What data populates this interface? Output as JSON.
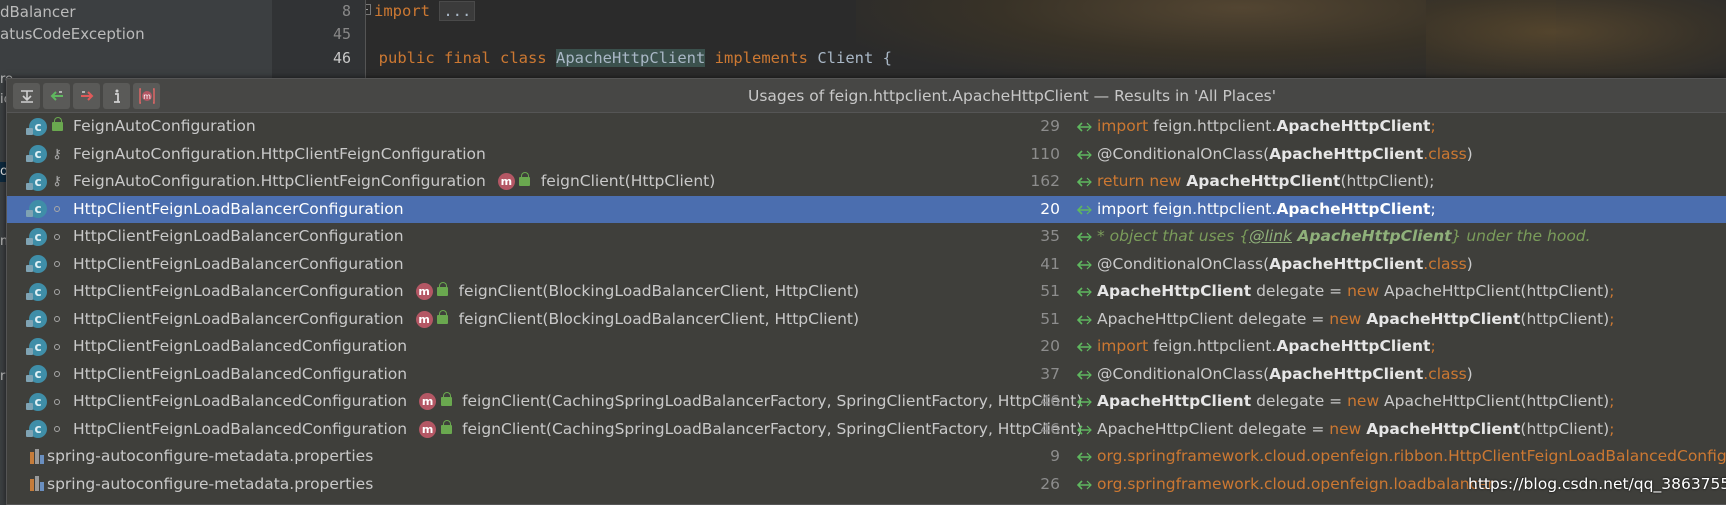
{
  "project_tree": {
    "items": [
      "dBalancer",
      "atusCodeException"
    ],
    "stubs": [
      "re",
      "ic",
      "or",
      "m",
      "ra"
    ]
  },
  "editor": {
    "line_numbers": [
      "8",
      "45",
      "46"
    ],
    "code": {
      "import_kw": "import",
      "import_folded": "...",
      "public_kw": "public final class",
      "class_name": "ApacheHttpClient",
      "implements_kw": "implements",
      "client": "Client {"
    }
  },
  "usages_popup": {
    "title": "Usages of feign.httpclient.ApacheHttpClient — Results in 'All Places'",
    "toolbar": [
      "expand-all-icon",
      "previous-occurrence-icon",
      "next-occurrence-icon",
      "info-icon",
      "method-filter-icon"
    ],
    "rows": [
      {
        "icon": "class-icon",
        "vis": "lock",
        "name": "FeignAutoConfiguration",
        "method": "",
        "line": "29",
        "code": [
          {
            "t": "import ",
            "c": "kw"
          },
          {
            "t": "feign.httpclient.",
            "c": "txt"
          },
          {
            "t": "ApacheHttpClient",
            "c": "b"
          },
          {
            "t": ";",
            "c": "kw"
          }
        ]
      },
      {
        "icon": "class-icon",
        "vis": "key",
        "name": "FeignAutoConfiguration.HttpClientFeignConfiguration",
        "method": "",
        "line": "110",
        "code": [
          {
            "t": "@ConditionalOnClass(",
            "c": "txt"
          },
          {
            "t": "ApacheHttpClient",
            "c": "b"
          },
          {
            "t": ".class",
            "c": "kw"
          },
          {
            "t": ")",
            "c": "txt"
          }
        ]
      },
      {
        "icon": "class-icon",
        "vis": "key",
        "name": "FeignAutoConfiguration.HttpClientFeignConfiguration",
        "method": "feignClient(HttpClient)",
        "line": "162",
        "code": [
          {
            "t": "return new ",
            "c": "kw"
          },
          {
            "t": "ApacheHttpClient",
            "c": "b"
          },
          {
            "t": "(httpClient);",
            "c": "txt"
          }
        ]
      },
      {
        "icon": "class-icon",
        "vis": "dot",
        "name": "HttpClientFeignLoadBalancerConfiguration",
        "method": "",
        "line": "20",
        "selected": true,
        "code": [
          {
            "t": "import ",
            "c": "txt"
          },
          {
            "t": "feign.httpclient.",
            "c": "txt"
          },
          {
            "t": "ApacheHttpClient",
            "c": "b"
          },
          {
            "t": ";",
            "c": "txt"
          }
        ]
      },
      {
        "icon": "class-icon",
        "vis": "dot",
        "name": "HttpClientFeignLoadBalancerConfiguration",
        "method": "",
        "line": "35",
        "code": [
          {
            "t": "* object that uses {",
            "c": "comment"
          },
          {
            "t": "@link",
            "c": "link"
          },
          {
            "t": " ApacheHttpClient",
            "c": "commentb"
          },
          {
            "t": "} under the hood.",
            "c": "comment"
          }
        ]
      },
      {
        "icon": "class-icon",
        "vis": "dot",
        "name": "HttpClientFeignLoadBalancerConfiguration",
        "method": "",
        "line": "41",
        "code": [
          {
            "t": "@ConditionalOnClass(",
            "c": "txt"
          },
          {
            "t": "ApacheHttpClient",
            "c": "b"
          },
          {
            "t": ".class",
            "c": "kw"
          },
          {
            "t": ")",
            "c": "txt"
          }
        ]
      },
      {
        "icon": "class-icon",
        "vis": "dot",
        "name": "HttpClientFeignLoadBalancerConfiguration",
        "method": "feignClient(BlockingLoadBalancerClient, HttpClient)",
        "line": "51",
        "code": [
          {
            "t": "ApacheHttpClient",
            "c": "b"
          },
          {
            "t": " delegate = ",
            "c": "txt"
          },
          {
            "t": "new ",
            "c": "kw"
          },
          {
            "t": "ApacheHttpClient(httpClient)",
            "c": "txt"
          },
          {
            "t": ";",
            "c": "kw"
          }
        ]
      },
      {
        "icon": "class-icon",
        "vis": "dot",
        "name": "HttpClientFeignLoadBalancerConfiguration",
        "method": "feignClient(BlockingLoadBalancerClient, HttpClient)",
        "line": "51",
        "code": [
          {
            "t": "ApacheHttpClient delegate = ",
            "c": "txt"
          },
          {
            "t": "new ",
            "c": "kw"
          },
          {
            "t": "ApacheHttpClient",
            "c": "b"
          },
          {
            "t": "(httpClient)",
            "c": "txt"
          },
          {
            "t": ";",
            "c": "kw"
          }
        ]
      },
      {
        "icon": "class-icon",
        "vis": "dot",
        "name": "HttpClientFeignLoadBalancedConfiguration",
        "method": "",
        "line": "20",
        "code": [
          {
            "t": "import ",
            "c": "kw"
          },
          {
            "t": "feign.httpclient.",
            "c": "txt"
          },
          {
            "t": "ApacheHttpClient",
            "c": "b"
          },
          {
            "t": ";",
            "c": "kw"
          }
        ]
      },
      {
        "icon": "class-icon",
        "vis": "dot",
        "name": "HttpClientFeignLoadBalancedConfiguration",
        "method": "",
        "line": "37",
        "code": [
          {
            "t": "@ConditionalOnClass(",
            "c": "txt"
          },
          {
            "t": "ApacheHttpClient",
            "c": "b"
          },
          {
            "t": ".class",
            "c": "kw"
          },
          {
            "t": ")",
            "c": "txt"
          }
        ]
      },
      {
        "icon": "class-icon",
        "vis": "dot",
        "name": "HttpClientFeignLoadBalancedConfiguration",
        "method": "feignClient(CachingSpringLoadBalancerFactory, SpringClientFactory, HttpClient)",
        "line": "46",
        "code": [
          {
            "t": "ApacheHttpClient",
            "c": "b"
          },
          {
            "t": " delegate = ",
            "c": "txt"
          },
          {
            "t": "new ",
            "c": "kw"
          },
          {
            "t": "ApacheHttpClient(httpClient)",
            "c": "txt"
          },
          {
            "t": ";",
            "c": "kw"
          }
        ]
      },
      {
        "icon": "class-icon",
        "vis": "dot",
        "name": "HttpClientFeignLoadBalancedConfiguration",
        "method": "feignClient(CachingSpringLoadBalancerFactory, SpringClientFactory, HttpClient)",
        "line": "46",
        "code": [
          {
            "t": "ApacheHttpClient delegate = ",
            "c": "txt"
          },
          {
            "t": "new ",
            "c": "kw"
          },
          {
            "t": "ApacheHttpClient",
            "c": "b"
          },
          {
            "t": "(httpClient)",
            "c": "txt"
          },
          {
            "t": ";",
            "c": "kw"
          }
        ]
      },
      {
        "icon": "properties-icon",
        "vis": "",
        "name": "spring-autoconfigure-metadata.properties",
        "method": "",
        "line": "9",
        "code": [
          {
            "t": "org.springframework.cloud.openfeign.ribbon.HttpClientFeignLoadBalancedConfigurat",
            "c": "prop"
          }
        ]
      },
      {
        "icon": "properties-icon",
        "vis": "",
        "name": "spring-autoconfigure-metadata.properties",
        "method": "",
        "line": "26",
        "code": [
          {
            "t": "org.springframework.cloud.openfeign.loadbalancer",
            "c": "prop"
          }
        ]
      }
    ]
  },
  "watermark": "https://blog.csdn.net/qq_38637558"
}
